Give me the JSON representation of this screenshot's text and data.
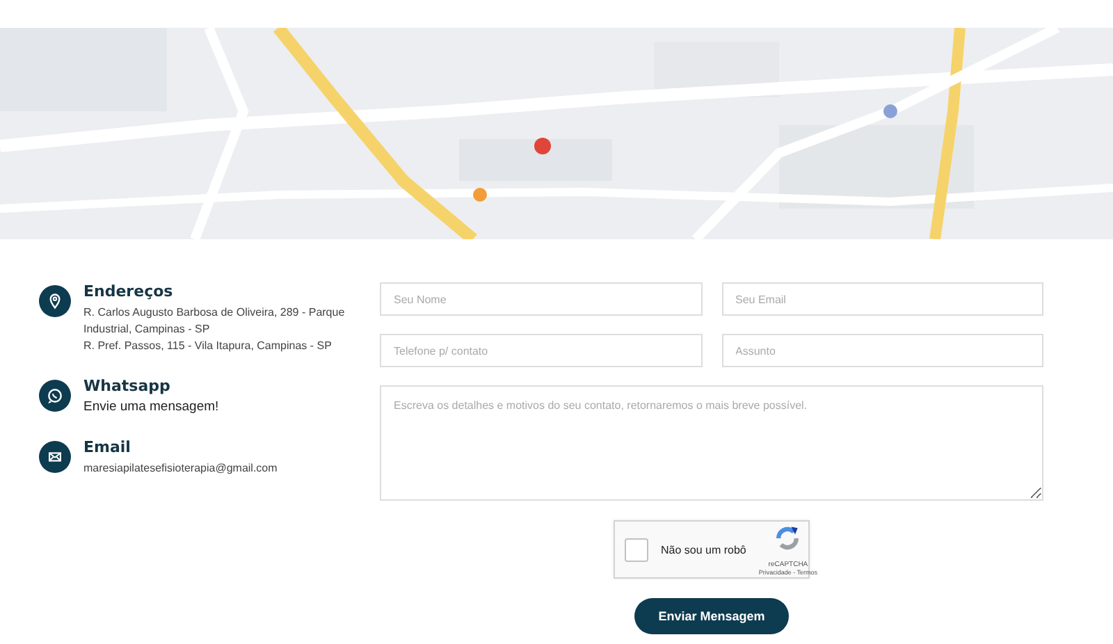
{
  "contacts": [
    {
      "kind": "address",
      "title": "Endereços",
      "lines": [
        "R. Carlos Augusto Barbosa de Oliveira, 289 - Parque Industrial, Campinas - SP",
        "R. Pref. Passos, 115 - Vila Itapura, Campinas - SP"
      ]
    },
    {
      "kind": "whatsapp",
      "title": "Whatsapp",
      "lines": [
        "Envie uma mensagem!"
      ]
    },
    {
      "kind": "email",
      "title": "Email",
      "lines": [
        "maresiapilatesefisioterapia@gmail.com"
      ]
    }
  ],
  "form": {
    "fields": [
      {
        "placeholder": "Seu Nome"
      },
      {
        "placeholder": "Seu Email"
      },
      {
        "placeholder": "Telefone p/ contato"
      },
      {
        "placeholder": "Assunto"
      }
    ],
    "message": {
      "placeholder": "Escreva os detalhes e motivos do seu contato, retornaremos o mais breve possível."
    },
    "captcha": {
      "checked": false,
      "label": "Não sou um robô",
      "brand": "reCAPTCHA",
      "links": "Privacidade - Termos"
    },
    "submit": "Enviar Mensagem"
  }
}
